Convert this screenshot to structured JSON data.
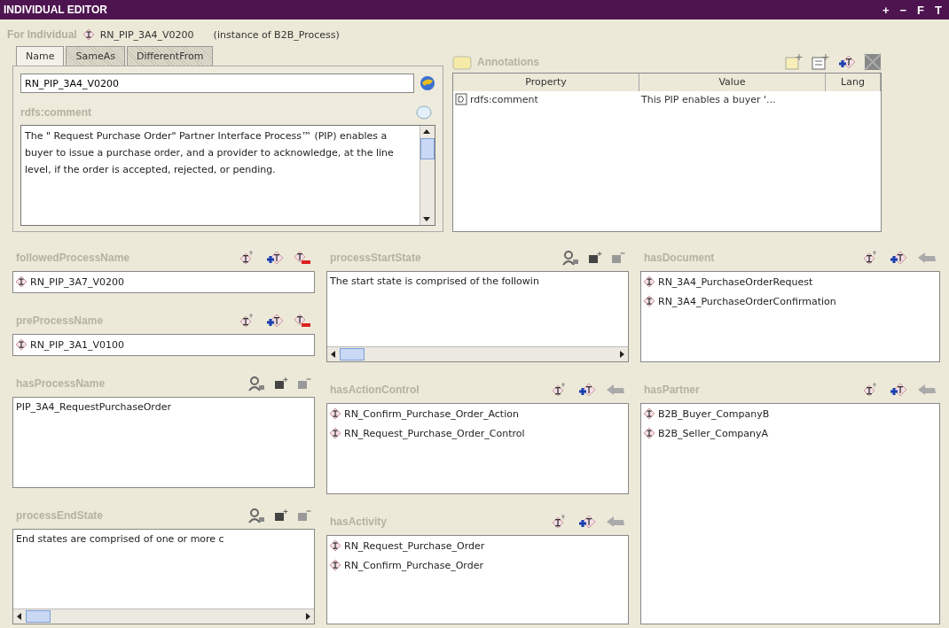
{
  "window": {
    "title": "INDIVIDUAL EDITOR",
    "controls": [
      "+",
      "−",
      "F",
      "T"
    ]
  },
  "individual": {
    "label": "For Individual",
    "name": "RN_PIP_3A4_V0200",
    "type_note": "(instance of B2B_Process)"
  },
  "tabs": [
    {
      "label": "Name",
      "selected": true
    },
    {
      "label": "SameAs",
      "selected": false
    },
    {
      "label": "DifferentFrom",
      "selected": false
    }
  ],
  "name_field": {
    "value": "RN_PIP_3A4_V0200"
  },
  "comment": {
    "label": "rdfs:comment",
    "value": "The \" Request Purchase Order\" Partner Interface Process™ (PIP) enables a buyer to issue a purchase order, and a provider to acknowledge, at the line level, if the order is accepted, rejected, or pending."
  },
  "annotations": {
    "title": "Annotations",
    "columns": [
      "Property",
      "Value",
      "Lang"
    ],
    "rows": [
      {
        "property": "rdfs:comment",
        "value": "This PIP enables a buyer '..."
      }
    ]
  },
  "columns": [
    [
      {
        "label": "followedProcessName",
        "kind": "field",
        "items": [
          "RN_PIP_3A7_V0200"
        ]
      },
      {
        "label": "preProcessName",
        "kind": "field",
        "items": [
          "RN_PIP_3A1_V0100"
        ]
      },
      {
        "label": "hasProcessName",
        "kind": "text",
        "value": "PIP_3A4_RequestPurchaseOrder",
        "hscroll": false
      },
      {
        "label": "processEndState",
        "kind": "text",
        "value": "End states are comprised of one or more c",
        "hscroll": true
      }
    ],
    [
      {
        "label": "processStartState",
        "kind": "text",
        "value": "The start state is comprised of the followin",
        "hscroll": true
      },
      {
        "label": "hasActionControl",
        "kind": "list",
        "items": [
          "RN_Confirm_Purchase_Order_Action",
          "RN_Request_Purchase_Order_Control"
        ]
      },
      {
        "label": "hasActivity",
        "kind": "list",
        "items": [
          "RN_Request_Purchase_Order",
          "RN_Confirm_Purchase_Order"
        ]
      }
    ],
    [
      {
        "label": "hasDocument",
        "kind": "list",
        "items": [
          "RN_3A4_PurchaseOrderRequest",
          "RN_3A4_PurchaseOrderConfirmation"
        ]
      },
      {
        "label": "hasPartner",
        "kind": "list",
        "items": [
          "B2B_Buyer_CompanyB",
          "B2B_Seller_CompanyA"
        ]
      }
    ]
  ]
}
